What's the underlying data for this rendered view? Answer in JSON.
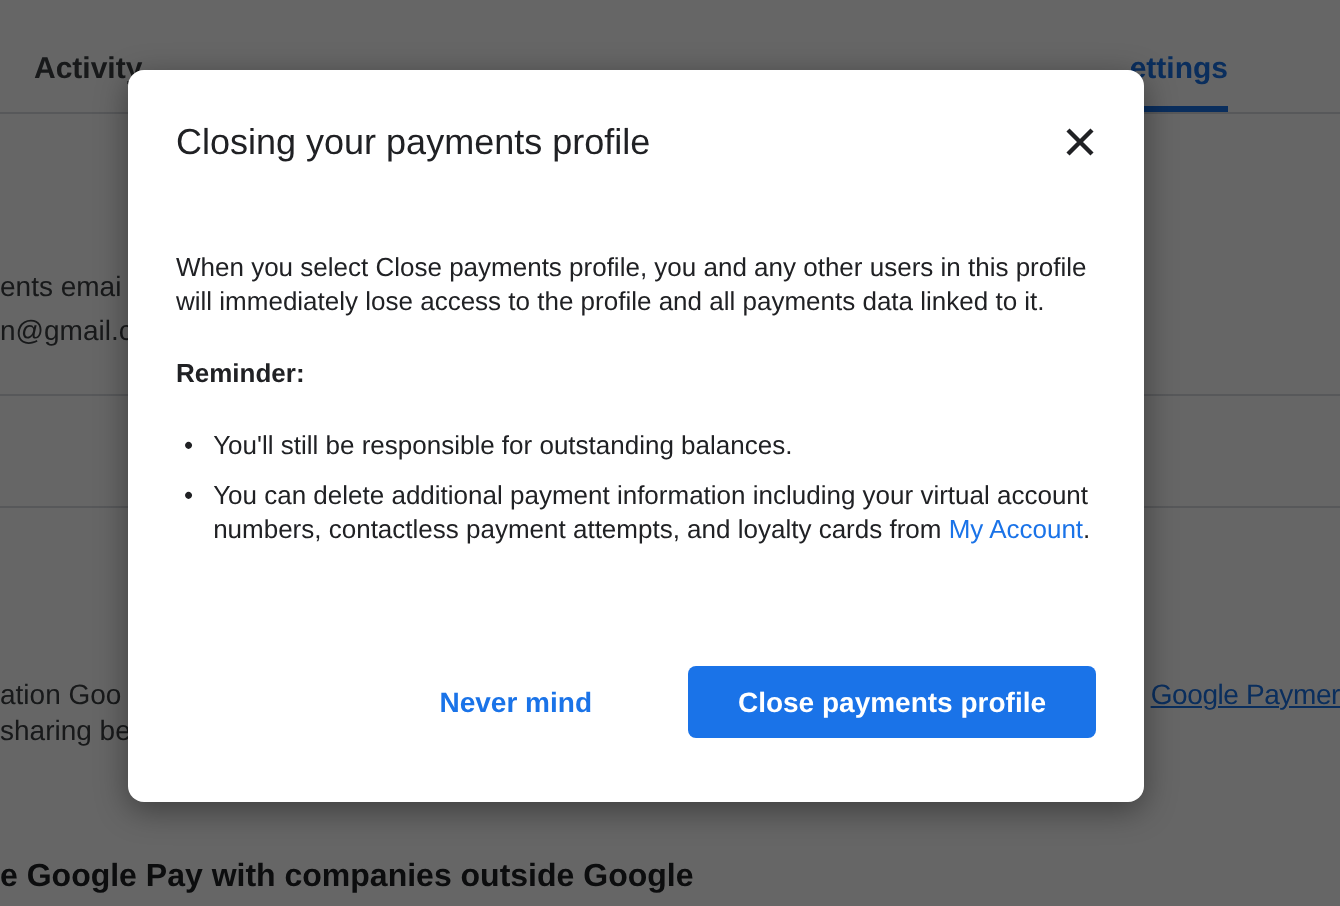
{
  "tabs": [
    {
      "label": "Activity",
      "selected": false
    },
    {
      "label": "ettings",
      "selected": true
    }
  ],
  "background": {
    "email_label": "ents emai",
    "email_value": "n@gmail.c",
    "info_text": "ation Goo",
    "info_text_2": "sharing be",
    "info_link": "Google Paymer",
    "heading": "e Google Pay with companies outside Google"
  },
  "dialog": {
    "title": "Closing your payments profile",
    "intro": "When you select Close payments profile, you and any other users in this profile will immediately lose access to the profile and all payments data linked to it.",
    "reminder_label": "Reminder:",
    "bullets": [
      {
        "marker": "•",
        "text": "You'll still be responsible for outstanding balances."
      },
      {
        "marker": "•",
        "text": "You can delete additional payment information including your virtual account numbers, contactless payment attempts, and loyalty cards from ",
        "link": "My Account",
        "tail": "."
      }
    ],
    "buttons": [
      {
        "label": "Never mind",
        "kind": "text"
      },
      {
        "label": "Close payments profile",
        "kind": "primary"
      }
    ]
  }
}
